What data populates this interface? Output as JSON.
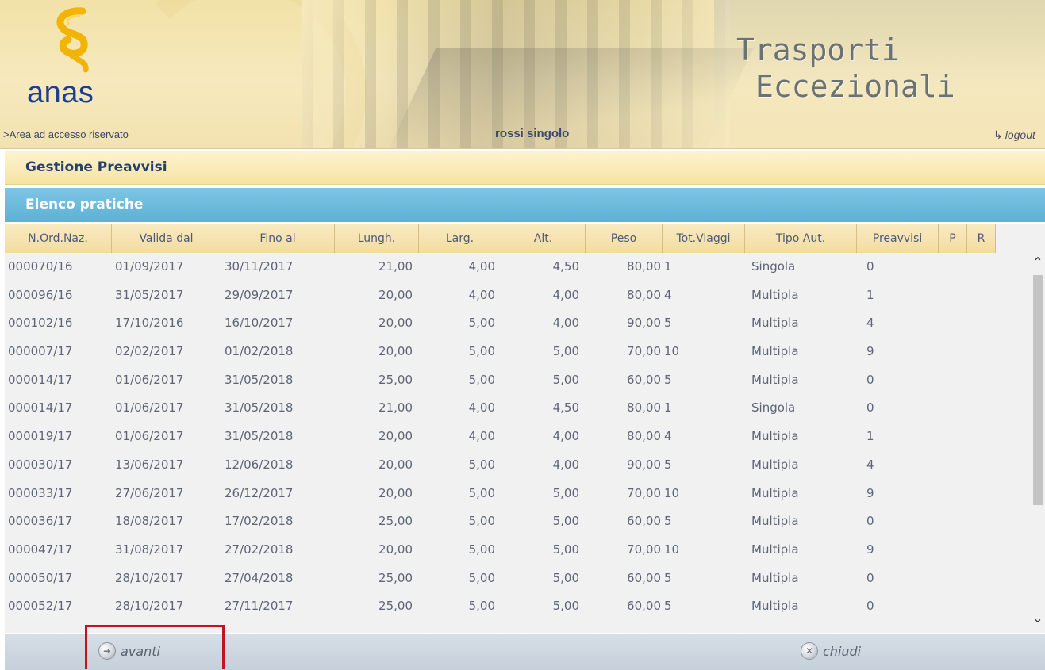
{
  "header": {
    "logo_text": "anas",
    "area_link": ">Area ad accesso riservato",
    "user_name": "rossi singolo",
    "app_title_line1": "Trasporti",
    "app_title_line2": "Eccezionali",
    "logout_label": "logout"
  },
  "section": {
    "title": "Gestione Preavvisi"
  },
  "list": {
    "title": "Elenco pratiche"
  },
  "table": {
    "columns": [
      "N.Ord.Naz.",
      "Valida dal",
      "Fino al",
      "Lungh.",
      "Larg.",
      "Alt.",
      "Peso",
      "Tot.Viaggi",
      "Tipo Aut.",
      "Preavvisi",
      "P",
      "R"
    ],
    "rows": [
      [
        "000070/16",
        "01/09/2017",
        "30/11/2017",
        "21,00",
        "4,00",
        "4,50",
        "80,00",
        "1",
        "Singola",
        "0",
        "",
        ""
      ],
      [
        "000096/16",
        "31/05/2017",
        "29/09/2017",
        "20,00",
        "4,00",
        "4,00",
        "80,00",
        "4",
        "Multipla",
        "1",
        "",
        ""
      ],
      [
        "000102/16",
        "17/10/2016",
        "16/10/2017",
        "20,00",
        "5,00",
        "4,00",
        "90,00",
        "5",
        "Multipla",
        "4",
        "",
        ""
      ],
      [
        "000007/17",
        "02/02/2017",
        "01/02/2018",
        "20,00",
        "5,00",
        "5,00",
        "70,00",
        "10",
        "Multipla",
        "9",
        "",
        ""
      ],
      [
        "000014/17",
        "01/06/2017",
        "31/05/2018",
        "25,00",
        "5,00",
        "5,00",
        "60,00",
        "5",
        "Multipla",
        "0",
        "",
        ""
      ],
      [
        "000014/17",
        "01/06/2017",
        "31/05/2018",
        "21,00",
        "4,00",
        "4,50",
        "80,00",
        "1",
        "Singola",
        "0",
        "",
        ""
      ],
      [
        "000019/17",
        "01/06/2017",
        "31/05/2018",
        "20,00",
        "4,00",
        "4,00",
        "80,00",
        "4",
        "Multipla",
        "1",
        "",
        ""
      ],
      [
        "000030/17",
        "13/06/2017",
        "12/06/2018",
        "20,00",
        "5,00",
        "4,00",
        "90,00",
        "5",
        "Multipla",
        "4",
        "",
        ""
      ],
      [
        "000033/17",
        "27/06/2017",
        "26/12/2017",
        "20,00",
        "5,00",
        "5,00",
        "70,00",
        "10",
        "Multipla",
        "9",
        "",
        ""
      ],
      [
        "000036/17",
        "18/08/2017",
        "17/02/2018",
        "25,00",
        "5,00",
        "5,00",
        "60,00",
        "5",
        "Multipla",
        "0",
        "",
        ""
      ],
      [
        "000047/17",
        "31/08/2017",
        "27/02/2018",
        "20,00",
        "5,00",
        "5,00",
        "70,00",
        "10",
        "Multipla",
        "9",
        "",
        ""
      ],
      [
        "000050/17",
        "28/10/2017",
        "27/04/2018",
        "25,00",
        "5,00",
        "5,00",
        "60,00",
        "5",
        "Multipla",
        "0",
        "",
        ""
      ],
      [
        "000052/17",
        "28/10/2017",
        "27/11/2017",
        "25,00",
        "5,00",
        "5,00",
        "60,00",
        "5",
        "Multipla",
        "0",
        "",
        ""
      ]
    ]
  },
  "footer": {
    "next_label": "avanti",
    "close_label": "chiudi"
  },
  "icons": {
    "logo": "anas-logo-icon",
    "logout": "logout-icon",
    "next": "arrow-right-icon",
    "close": "close-icon",
    "scroll_up": "chevron-up-icon",
    "scroll_down": "chevron-down-icon"
  },
  "colors": {
    "brand_blue": "#1a3f93",
    "logo_yellow": "#f2b400",
    "list_bar": "#5cb1d6",
    "highlight": "#c0141e"
  }
}
